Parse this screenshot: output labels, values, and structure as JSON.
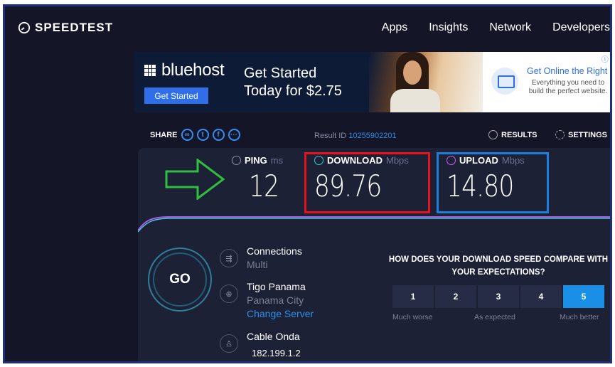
{
  "header": {
    "logo_text": "SPEEDTEST",
    "nav": [
      "Apps",
      "Insights",
      "Network",
      "Developers"
    ]
  },
  "ad": {
    "brand": "bluehost",
    "cta": "Get Started",
    "headline_line1": "Get Started",
    "headline_line2": "Today for $2.75",
    "right_title": "Get Online the Right Way",
    "right_sub": "Everything you need to build the perfect website.",
    "choices_icon": "ⓘ ✕"
  },
  "share": {
    "label": "SHARE",
    "icons": [
      "link-icon",
      "twitter-icon",
      "facebook-icon",
      "more-icon"
    ],
    "result_id_label": "Result ID",
    "result_id": "10255902201",
    "results_label": "RESULTS",
    "settings_label": "SETTINGS"
  },
  "metrics": {
    "ping": {
      "label": "PING",
      "unit": "ms",
      "value": "12"
    },
    "download": {
      "label": "DOWNLOAD",
      "unit": "Mbps",
      "value": "89.76"
    },
    "upload": {
      "label": "UPLOAD",
      "unit": "Mbps",
      "value": "14.80"
    }
  },
  "go_label": "GO",
  "connections": {
    "label": "Connections",
    "value": "Multi"
  },
  "server": {
    "name": "Tigo Panama",
    "city": "Panama City",
    "change": "Change Server"
  },
  "isp": {
    "name": "Cable Onda",
    "ip": "182.199.1.2"
  },
  "survey": {
    "question": "HOW DOES YOUR DOWNLOAD SPEED COMPARE WITH YOUR EXPECTATIONS?",
    "options": [
      "1",
      "2",
      "3",
      "4",
      "5"
    ],
    "selected": "5",
    "low_label": "Much worse",
    "mid_label": "As expected",
    "high_label": "Much better"
  },
  "colors": {
    "download_highlight": "#e8121b",
    "upload_highlight": "#1c7fe0",
    "annotation_arrow": "#2fbf3f",
    "accent": "#1a8fe6"
  }
}
